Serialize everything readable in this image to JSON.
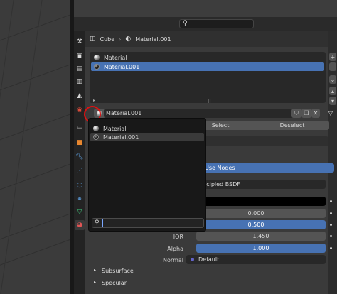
{
  "breadcrumb": {
    "object": "Cube",
    "material": "Material.001"
  },
  "material_slots": [
    {
      "label": "Material",
      "selected": false
    },
    {
      "label": "Material.001",
      "selected": true
    }
  ],
  "material_selector": {
    "name": "Material.001"
  },
  "dropdown": {
    "items": [
      {
        "label": "Material",
        "highlighted": false
      },
      {
        "label": "Material.001",
        "highlighted": true
      }
    ],
    "search_value": ""
  },
  "buttons": {
    "select": "Select",
    "deselect": "Deselect",
    "use_nodes": "Use Nodes"
  },
  "surface": {
    "shader_partial": "ıcipled BSDF"
  },
  "properties": [
    {
      "label": "",
      "value": "0.000"
    },
    {
      "label": "",
      "value": "0.500"
    },
    {
      "label": "IOR",
      "value": "1.450"
    },
    {
      "label": "Alpha",
      "value": "1.000"
    },
    {
      "label": "Normal",
      "value": "Default"
    }
  ],
  "sections": {
    "subsurface": "Subsurface",
    "specular": "Specular"
  },
  "colors": {
    "accent": "#4772b3",
    "highlight_mark": "#e01010"
  }
}
